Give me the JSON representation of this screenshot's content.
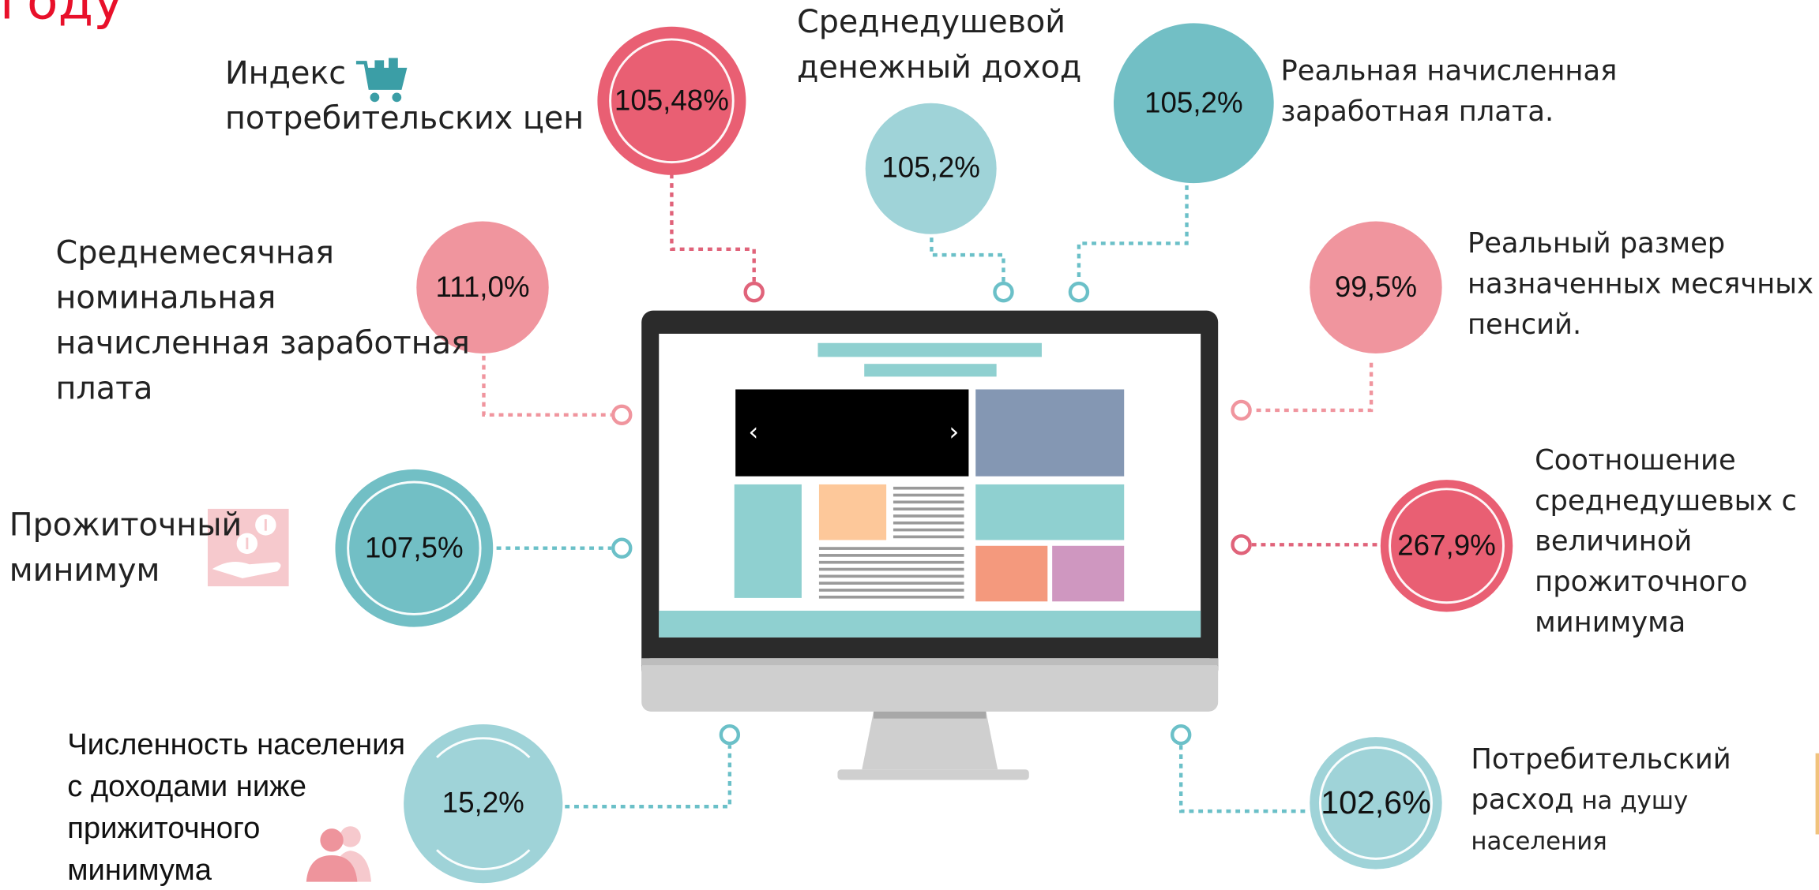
{
  "heading": "году",
  "colors": {
    "red": "#e95f73",
    "pink": "#f0959e",
    "teal": "#72bfc5",
    "light_teal": "#9fd3d8",
    "dotted_red": "#e0637a",
    "dotted_teal": "#6bc0c8"
  },
  "indicators": {
    "cpi": {
      "label_line1": "Индекс",
      "label_line2": "потребительских цен",
      "value": "105,48%"
    },
    "income": {
      "label_line1": "Среднедушевой",
      "label_line2": "денежный доход",
      "value": "105,2%"
    },
    "real_wage": {
      "label_line1": "Реальная начисленная",
      "label_line2": "заработная плата.",
      "value": "105,2%"
    },
    "nominal_wage": {
      "label_line1": "Среднемесячная",
      "label_line2": "номинальная",
      "label_line3": "начисленная заработная",
      "label_line4": "плата",
      "value": "111,0%"
    },
    "pension": {
      "label_line1": "Реальный размер",
      "label_line2": "назначенных месячных",
      "label_line3": "пенсий.",
      "value": "99,5%"
    },
    "subsistence": {
      "label_line1": "Прожиточный",
      "label_line2": "минимум",
      "value": "107,5%"
    },
    "ratio": {
      "label_line1": "Соотношение",
      "label_line2": "среднедушевых с",
      "label_line3": "величиной",
      "label_line4": "прожиточного",
      "label_line5": "минимума",
      "value": "267,9%"
    },
    "poverty": {
      "label_line1": "Численность населения",
      "label_line2": "с доходами ниже",
      "label_line3": "прижиточного",
      "label_line4": "минимума",
      "value": "15,2%"
    },
    "consumer": {
      "label_line1": "Потребительский",
      "label_line2_a": "расход",
      "label_line2_b": " на душу",
      "label_line3": "населения",
      "value": "102,6%"
    }
  },
  "icons": {
    "cart": "shopping-cart-icon",
    "coins": "hand-coins-icon",
    "people": "people-icon",
    "monitor": "monitor-illustration",
    "arrow_left": "‹",
    "arrow_right": "›"
  }
}
